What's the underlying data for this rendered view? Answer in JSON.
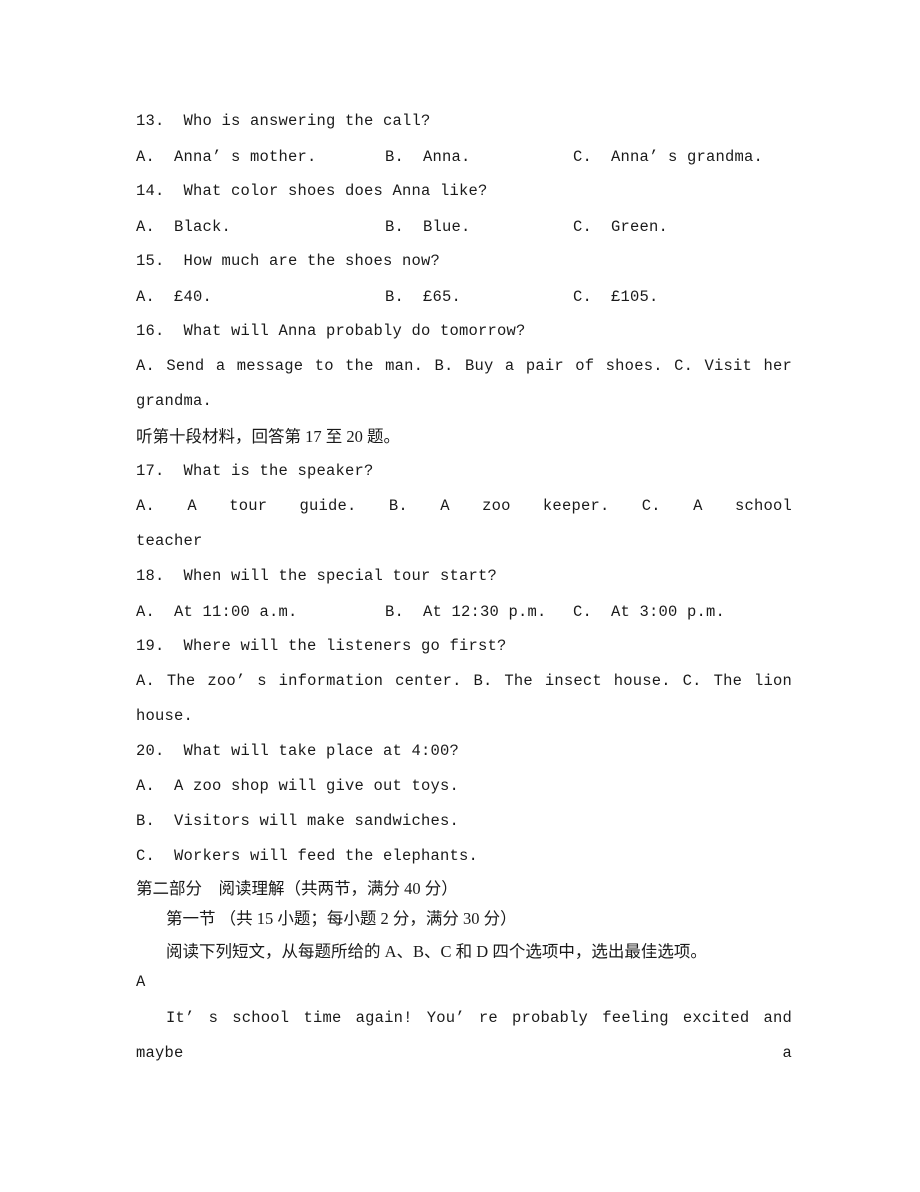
{
  "document": {
    "type": "english-exam-paper",
    "page_background": "#ffffff",
    "text_color": "#1a1a1a"
  },
  "listening_section": {
    "questions": [
      {
        "number": "13.",
        "stem": "13.  Who is answering the call?",
        "layout": "three-column",
        "options": [
          "A.  Anna’ s mother.",
          "B.  Anna.",
          "C.  Anna’ s grandma."
        ]
      },
      {
        "number": "14.",
        "stem": "14.  What color shoes does Anna like?",
        "layout": "three-column",
        "options": [
          "A.  Black.",
          "B.  Blue.",
          "C.  Green."
        ]
      },
      {
        "number": "15.",
        "stem": "15.  How much are the shoes now?",
        "layout": "three-column",
        "options": [
          "A.  £40.",
          "B.  £65.",
          "C.  £105."
        ]
      },
      {
        "number": "16.",
        "stem": "16.  What will Anna probably do tomorrow?",
        "layout": "justified-wrap",
        "options_line": "A.  Send a message to the man.   B.  Buy a pair of shoes.  C.   Visit   her",
        "options_wrap": "grandma."
      }
    ],
    "material_notice": "听第十段材料，回答第 17 至 20 题。",
    "questions2": [
      {
        "number": "17.",
        "stem": "17.  What is the speaker?",
        "layout": "justified-wrap",
        "options_line": "A.  A tour guide.                B.  A zoo keeper.         C.    A    school",
        "options_wrap": "teacher"
      },
      {
        "number": "18.",
        "stem": "18.  When will the special tour start?",
        "layout": "three-column",
        "options": [
          "A.  At 11:00 a.m.",
          "B.  At 12:30 p.m.",
          "C.  At 3:00 p.m."
        ]
      },
      {
        "number": "19.",
        "stem": "19.  Where will the listeners go first?",
        "layout": "justified-wrap",
        "options_line": "A.  The zoo’ s information center.  B.  The insect house.    C.   The   lion",
        "options_wrap": "house."
      },
      {
        "number": "20.",
        "stem": "20.  What will take place at 4:00?",
        "layout": "stacked",
        "options": [
          "A.  A zoo shop will give out toys.",
          "B.  Visitors will make sandwiches.",
          "C.  Workers will feed the elephants."
        ]
      }
    ]
  },
  "reading_section": {
    "part_title": "第二部分　阅读理解（共两节，满分 40 分）",
    "subsection_title": "第一节 （共 15 小题；每小题 2 分，满分 30 分）",
    "instruction": "阅读下列短文，从每题所给的 A、B、C 和 D 四个选项中，选出最佳选项。",
    "passage_marker": "A",
    "passage_first_line": "It’ s school time again! You’ re probably feeling excited and maybe a"
  }
}
